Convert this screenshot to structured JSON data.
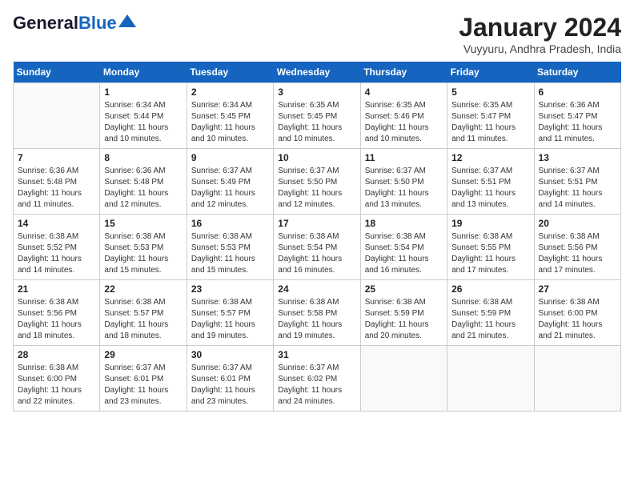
{
  "header": {
    "logo_general": "General",
    "logo_blue": "Blue",
    "title": "January 2024",
    "location": "Vuyyuru, Andhra Pradesh, India"
  },
  "columns": [
    "Sunday",
    "Monday",
    "Tuesday",
    "Wednesday",
    "Thursday",
    "Friday",
    "Saturday"
  ],
  "weeks": [
    [
      {
        "day": "",
        "info": ""
      },
      {
        "day": "1",
        "info": "Sunrise: 6:34 AM\nSunset: 5:44 PM\nDaylight: 11 hours and 10 minutes."
      },
      {
        "day": "2",
        "info": "Sunrise: 6:34 AM\nSunset: 5:45 PM\nDaylight: 11 hours and 10 minutes."
      },
      {
        "day": "3",
        "info": "Sunrise: 6:35 AM\nSunset: 5:45 PM\nDaylight: 11 hours and 10 minutes."
      },
      {
        "day": "4",
        "info": "Sunrise: 6:35 AM\nSunset: 5:46 PM\nDaylight: 11 hours and 10 minutes."
      },
      {
        "day": "5",
        "info": "Sunrise: 6:35 AM\nSunset: 5:47 PM\nDaylight: 11 hours and 11 minutes."
      },
      {
        "day": "6",
        "info": "Sunrise: 6:36 AM\nSunset: 5:47 PM\nDaylight: 11 hours and 11 minutes."
      }
    ],
    [
      {
        "day": "7",
        "info": "Sunrise: 6:36 AM\nSunset: 5:48 PM\nDaylight: 11 hours and 11 minutes."
      },
      {
        "day": "8",
        "info": "Sunrise: 6:36 AM\nSunset: 5:48 PM\nDaylight: 11 hours and 12 minutes."
      },
      {
        "day": "9",
        "info": "Sunrise: 6:37 AM\nSunset: 5:49 PM\nDaylight: 11 hours and 12 minutes."
      },
      {
        "day": "10",
        "info": "Sunrise: 6:37 AM\nSunset: 5:50 PM\nDaylight: 11 hours and 12 minutes."
      },
      {
        "day": "11",
        "info": "Sunrise: 6:37 AM\nSunset: 5:50 PM\nDaylight: 11 hours and 13 minutes."
      },
      {
        "day": "12",
        "info": "Sunrise: 6:37 AM\nSunset: 5:51 PM\nDaylight: 11 hours and 13 minutes."
      },
      {
        "day": "13",
        "info": "Sunrise: 6:37 AM\nSunset: 5:51 PM\nDaylight: 11 hours and 14 minutes."
      }
    ],
    [
      {
        "day": "14",
        "info": "Sunrise: 6:38 AM\nSunset: 5:52 PM\nDaylight: 11 hours and 14 minutes."
      },
      {
        "day": "15",
        "info": "Sunrise: 6:38 AM\nSunset: 5:53 PM\nDaylight: 11 hours and 15 minutes."
      },
      {
        "day": "16",
        "info": "Sunrise: 6:38 AM\nSunset: 5:53 PM\nDaylight: 11 hours and 15 minutes."
      },
      {
        "day": "17",
        "info": "Sunrise: 6:38 AM\nSunset: 5:54 PM\nDaylight: 11 hours and 16 minutes."
      },
      {
        "day": "18",
        "info": "Sunrise: 6:38 AM\nSunset: 5:54 PM\nDaylight: 11 hours and 16 minutes."
      },
      {
        "day": "19",
        "info": "Sunrise: 6:38 AM\nSunset: 5:55 PM\nDaylight: 11 hours and 17 minutes."
      },
      {
        "day": "20",
        "info": "Sunrise: 6:38 AM\nSunset: 5:56 PM\nDaylight: 11 hours and 17 minutes."
      }
    ],
    [
      {
        "day": "21",
        "info": "Sunrise: 6:38 AM\nSunset: 5:56 PM\nDaylight: 11 hours and 18 minutes."
      },
      {
        "day": "22",
        "info": "Sunrise: 6:38 AM\nSunset: 5:57 PM\nDaylight: 11 hours and 18 minutes."
      },
      {
        "day": "23",
        "info": "Sunrise: 6:38 AM\nSunset: 5:57 PM\nDaylight: 11 hours and 19 minutes."
      },
      {
        "day": "24",
        "info": "Sunrise: 6:38 AM\nSunset: 5:58 PM\nDaylight: 11 hours and 19 minutes."
      },
      {
        "day": "25",
        "info": "Sunrise: 6:38 AM\nSunset: 5:59 PM\nDaylight: 11 hours and 20 minutes."
      },
      {
        "day": "26",
        "info": "Sunrise: 6:38 AM\nSunset: 5:59 PM\nDaylight: 11 hours and 21 minutes."
      },
      {
        "day": "27",
        "info": "Sunrise: 6:38 AM\nSunset: 6:00 PM\nDaylight: 11 hours and 21 minutes."
      }
    ],
    [
      {
        "day": "28",
        "info": "Sunrise: 6:38 AM\nSunset: 6:00 PM\nDaylight: 11 hours and 22 minutes."
      },
      {
        "day": "29",
        "info": "Sunrise: 6:37 AM\nSunset: 6:01 PM\nDaylight: 11 hours and 23 minutes."
      },
      {
        "day": "30",
        "info": "Sunrise: 6:37 AM\nSunset: 6:01 PM\nDaylight: 11 hours and 23 minutes."
      },
      {
        "day": "31",
        "info": "Sunrise: 6:37 AM\nSunset: 6:02 PM\nDaylight: 11 hours and 24 minutes."
      },
      {
        "day": "",
        "info": ""
      },
      {
        "day": "",
        "info": ""
      },
      {
        "day": "",
        "info": ""
      }
    ]
  ]
}
